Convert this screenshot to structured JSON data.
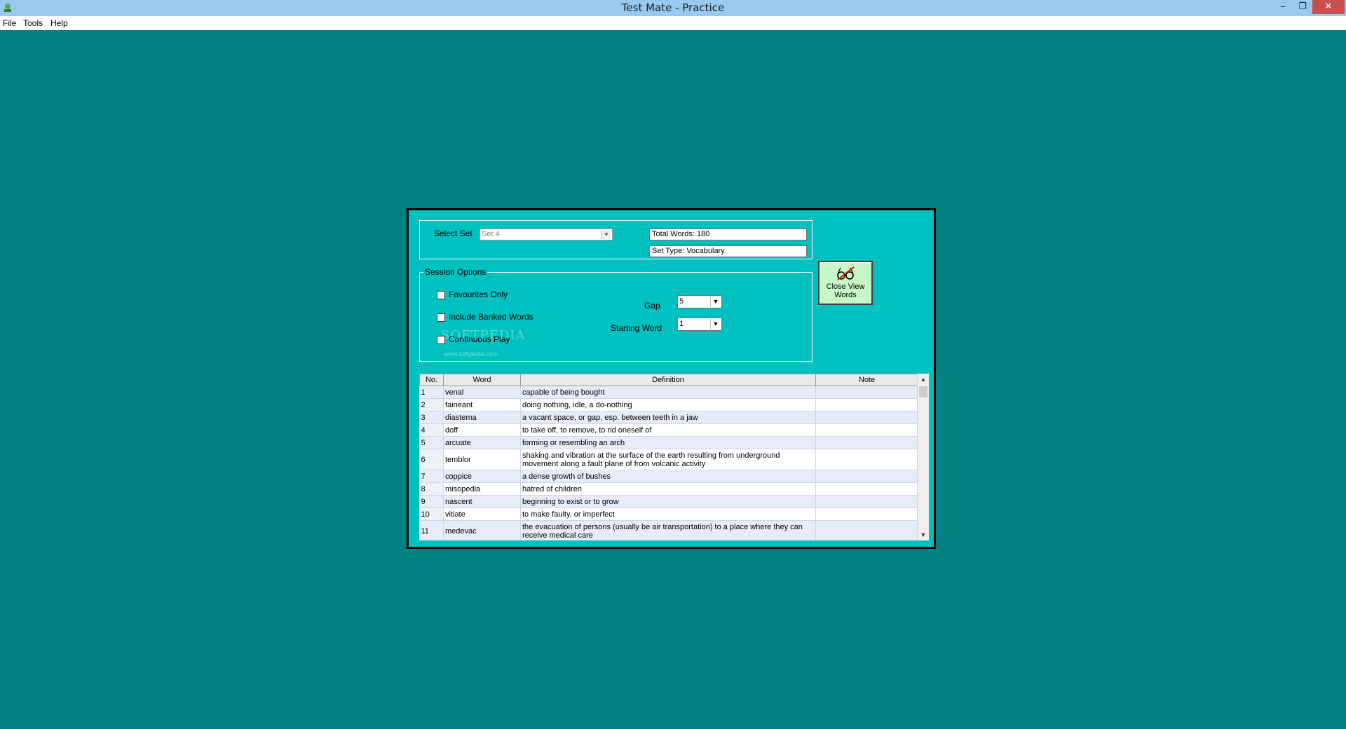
{
  "window": {
    "title": "Test Mate - Practice",
    "minimize": "–",
    "maximize": "❐",
    "close": "✕"
  },
  "menu": {
    "file": "File",
    "tools": "Tools",
    "help": "Help"
  },
  "set_box": {
    "select_set_label": "Select Set",
    "select_set_value": "Set 4",
    "total_words": "Total Words: 180",
    "set_type": "Set Type: Vocabulary"
  },
  "session": {
    "legend": "Session Options",
    "favourites_only": "Favourites Only",
    "include_banked": "Include Banked Words",
    "continuous_play": "Continuous Play",
    "gap_label": "Gap",
    "gap_value": "5",
    "starting_word_label": "Starting Word",
    "starting_word_value": "1"
  },
  "close_view_button": {
    "label": "Close View Words",
    "icon": "glasses-icon"
  },
  "watermark": {
    "text": "SOFTPEDIA",
    "url": "www.softpedia.com"
  },
  "table": {
    "headers": [
      "No.",
      "Word",
      "Definition",
      "Note"
    ],
    "rows": [
      [
        "1",
        "venal",
        "capable of being bought",
        ""
      ],
      [
        "2",
        "faineant",
        "doing nothing, idle, a do-nothing",
        ""
      ],
      [
        "3",
        "diastema",
        "a vacant space, or gap, esp. between teeth in a jaw",
        ""
      ],
      [
        "4",
        "doff",
        "to take off, to remove, to rid oneself of",
        ""
      ],
      [
        "5",
        "arcuate",
        "forming or resembling an arch",
        ""
      ],
      [
        "6",
        "temblor",
        "shaking and vibration at the surface of the earth resulting from underground movement along a fault plane of from volcanic activity",
        ""
      ],
      [
        "7",
        "coppice",
        "a dense growth of bushes",
        ""
      ],
      [
        "8",
        "misopedia",
        "hatred of children",
        ""
      ],
      [
        "9",
        "nascent",
        "beginning to exist or to grow",
        ""
      ],
      [
        "10",
        "vitiate",
        "to make faulty, or imperfect",
        ""
      ],
      [
        "11",
        "medevac",
        "the evacuation of persons (usually be air transportation) to a place where they can receive medical care",
        ""
      ]
    ]
  },
  "colors": {
    "desktop": "#008080",
    "panel": "#00c0c0",
    "title_bar": "#99c9ef",
    "close_btn": "#c7504d"
  }
}
